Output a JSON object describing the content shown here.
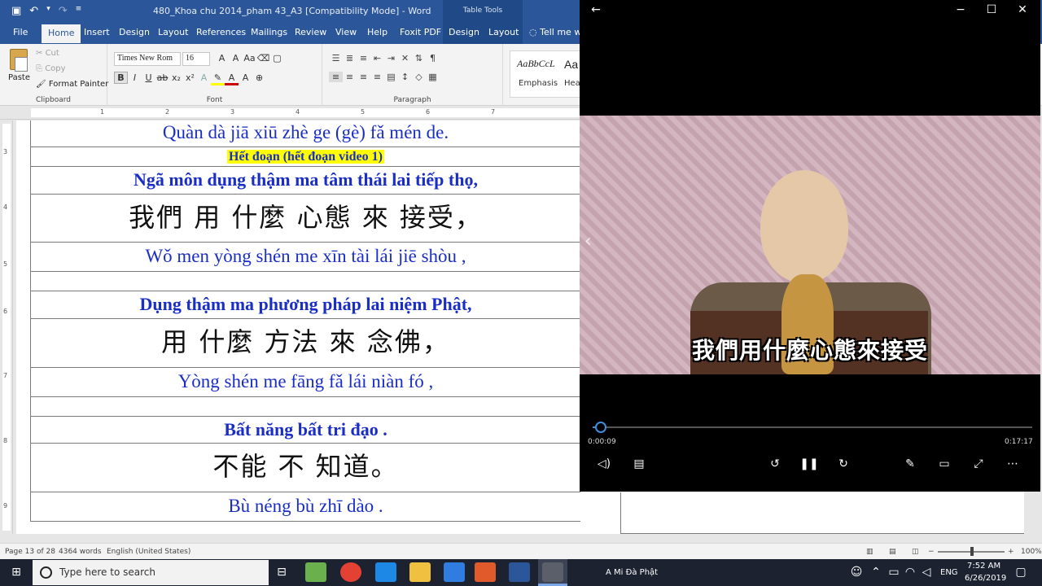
{
  "word": {
    "doc_title": "480_Khoa chu 2014_pham 43_A3 [Compatibility Mode]  -  Word",
    "context_tab_group": "Table Tools",
    "tabs": [
      "File",
      "Home",
      "Insert",
      "Design",
      "Layout",
      "References",
      "Mailings",
      "Review",
      "View",
      "Help",
      "Foxit PDF",
      "Design",
      "Layout",
      "Tell me w"
    ],
    "active_tab": "Home",
    "clipboard": {
      "paste": "Paste",
      "cut": "Cut",
      "copy": "Copy",
      "format_painter": "Format Painter",
      "label": "Clipboard"
    },
    "font": {
      "name": "Times New Rom",
      "size": "16",
      "label": "Font"
    },
    "paragraph_label": "Paragraph",
    "styles": {
      "sample1": "AaBbCcL",
      "name1": "Emphasis",
      "sample2": "Aa",
      "name2": "Hea"
    },
    "ruler_numbers": [
      "1",
      "2",
      "3",
      "4",
      "5",
      "6",
      "7"
    ],
    "vruler_numbers": [
      "3",
      "4",
      "5",
      "6",
      "7",
      "8",
      "9"
    ],
    "document": {
      "rows": [
        {
          "type": "pinyin",
          "text": "Quàn  dà jiā  xiū   zhè ge (gè)  fǎ mén   de."
        },
        {
          "type": "highlight",
          "text": "Hết đoạn (hết đoạn video 1)"
        },
        {
          "type": "viet",
          "text": "Ngã môn  dụng  thậm ma  tâm thái  lai  tiếp thọ,"
        },
        {
          "type": "chinese",
          "text": "我們  用  什麼  心態  來  接受，"
        },
        {
          "type": "pinyin",
          "text": "Wǒ men  yòng  shén me   xīn tài  lái   jiē shòu  ,"
        },
        {
          "type": "blank",
          "text": ""
        },
        {
          "type": "viet",
          "text": "Dụng  thậm ma  phương pháp  lai  niệm Phật,"
        },
        {
          "type": "chinese",
          "text": "用  什麼  方法  來  念佛，"
        },
        {
          "type": "pinyin",
          "text": "Yòng  shén me  fāng fǎ  lái   niàn fó    ,"
        },
        {
          "type": "blank",
          "text": ""
        },
        {
          "type": "viet",
          "text": "Bất năng   bất   tri đạo ."
        },
        {
          "type": "chinese",
          "text": "不能  不  知道。"
        },
        {
          "type": "pinyin",
          "text": "Bù néng  bù  zhī dào  ."
        }
      ]
    },
    "status": {
      "page": "Page 13 of 28",
      "words": "4364 words",
      "language": "English (United States)",
      "zoom": "100%"
    }
  },
  "player": {
    "subtitle": "我們用什麼心態來接受",
    "elapsed": "0:00:09",
    "duration": "0:17:17",
    "progress_fraction": 0.009
  },
  "taskbar": {
    "search_placeholder": "Type here to search",
    "notification_text": "A Mi Đà Phật",
    "language": "ENG",
    "time": "7:52 AM",
    "date": "6/26/2019"
  },
  "colors": {
    "word_blue": "#2b579a",
    "doc_text_blue": "#1a2ec5",
    "highlight": "#ffff00",
    "player_accent": "#3f8fe0"
  }
}
